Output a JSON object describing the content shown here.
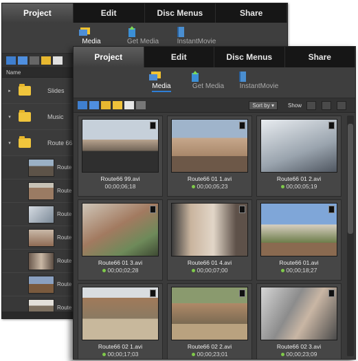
{
  "tabs": [
    "Project",
    "Edit",
    "Disc Menus",
    "Share"
  ],
  "tools": [
    "Media",
    "Get Media",
    "InstantMovie"
  ],
  "back": {
    "list_header": "Name",
    "folders": [
      "Slides",
      "Music",
      "Route 66"
    ],
    "clips": [
      "Route",
      "Route",
      "Route",
      "Route",
      "Route",
      "Route",
      "Route"
    ]
  },
  "sort_label": "Sort by",
  "show_label": "Show",
  "media": [
    {
      "name": "Route66 99.avi",
      "duration": "00;00;06;18",
      "dot": false
    },
    {
      "name": "Route66 01 1.avi",
      "duration": "00;00;05;23",
      "dot": true
    },
    {
      "name": "Route66 01 2.avi",
      "duration": "00;00;05;19",
      "dot": true
    },
    {
      "name": "Route66 01 3.avi",
      "duration": "00;00;02;28",
      "dot": true
    },
    {
      "name": "Route66 01 4.avi",
      "duration": "00;00;07;00",
      "dot": true
    },
    {
      "name": "Route66 01.avi",
      "duration": "00;00;18;27",
      "dot": true
    },
    {
      "name": "Route66 02 1.avi",
      "duration": "00;00;17;03",
      "dot": true
    },
    {
      "name": "Route66 02 2.avi",
      "duration": "00;00;23;01",
      "dot": true
    },
    {
      "name": "Route66 02 3.avi",
      "duration": "00;00;23;09",
      "dot": true
    }
  ]
}
